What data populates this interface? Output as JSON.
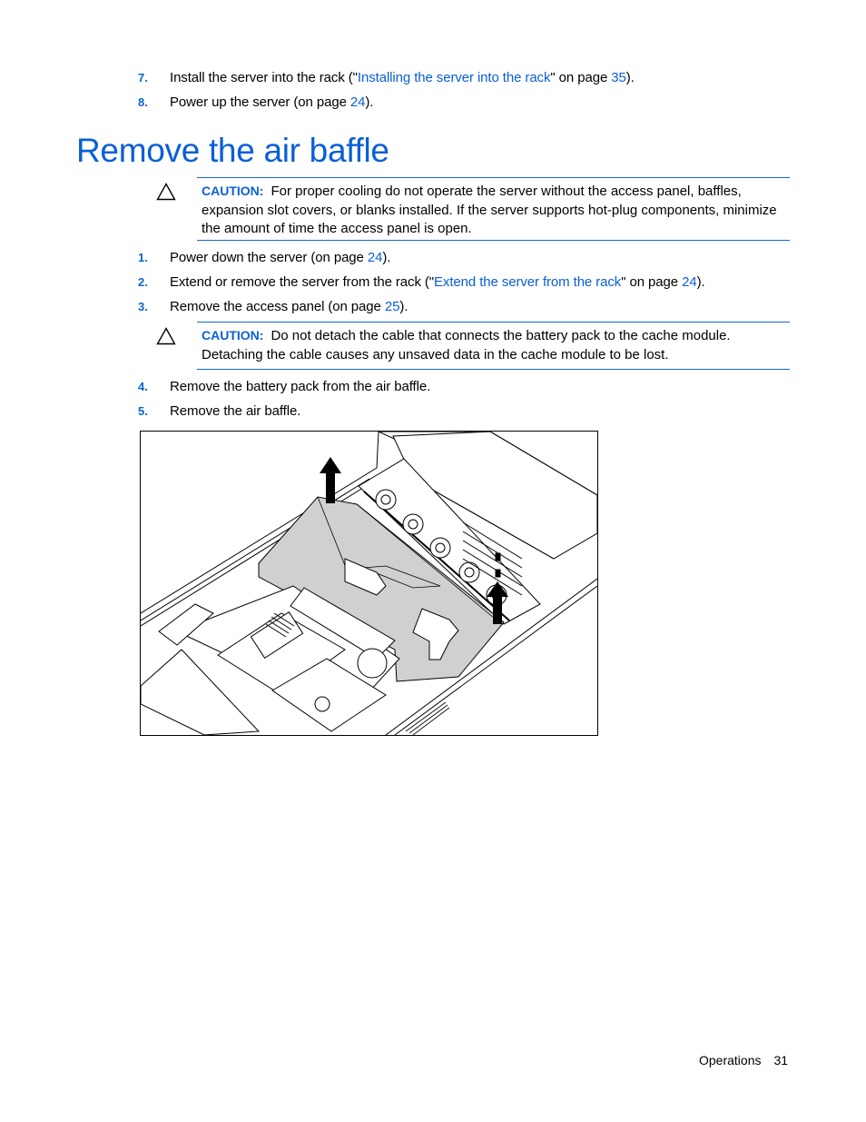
{
  "prev_steps": [
    {
      "number": "7.",
      "text_before": "Install the server into the rack (\"",
      "link": "Installing the server into the rack",
      "text_middle": "\" on page ",
      "page": "35",
      "text_after": ")."
    },
    {
      "number": "8.",
      "text_before": "Power up the server (on page ",
      "page": "24",
      "text_after": ")."
    }
  ],
  "section": {
    "title": "Remove the air baffle"
  },
  "cautions": [
    {
      "label": "CAUTION:",
      "text": "For proper cooling do not operate the server without the access panel, baffles, expansion slot covers, or blanks installed. If the server supports hot-plug components, minimize the amount of time the access panel is open.",
      "icon": "caution-triangle-icon"
    },
    {
      "label": "CAUTION:",
      "text": "Do not detach the cable that connects the battery pack to the cache module. Detaching the cable causes any unsaved data in the cache module to be lost.",
      "icon": "caution-triangle-icon"
    }
  ],
  "steps": [
    {
      "number": "1.",
      "text_before": "Power down the server (on page ",
      "page": "24",
      "text_after": ")."
    },
    {
      "number": "2.",
      "text_before": "Extend or remove the server from the rack (\"",
      "link": "Extend the server from the rack",
      "text_middle": "\" on page ",
      "page": "24",
      "text_after": ")."
    },
    {
      "number": "3.",
      "text_before": "Remove the access panel (on page ",
      "page": "25",
      "text_after": ")."
    },
    {
      "number": "4.",
      "text": "Remove the battery pack from the air baffle."
    },
    {
      "number": "5.",
      "text": "Remove the air baffle."
    }
  ],
  "figure": {
    "description": "Isometric line drawing of server chassis with shaded air baffle being lifted out, two up arrows"
  },
  "footer": {
    "section": "Operations",
    "page_number": "31"
  },
  "colors": {
    "accent": "#0a5fd6",
    "rule": "#1467d8",
    "baffle_fill": "#d0d0d0"
  }
}
